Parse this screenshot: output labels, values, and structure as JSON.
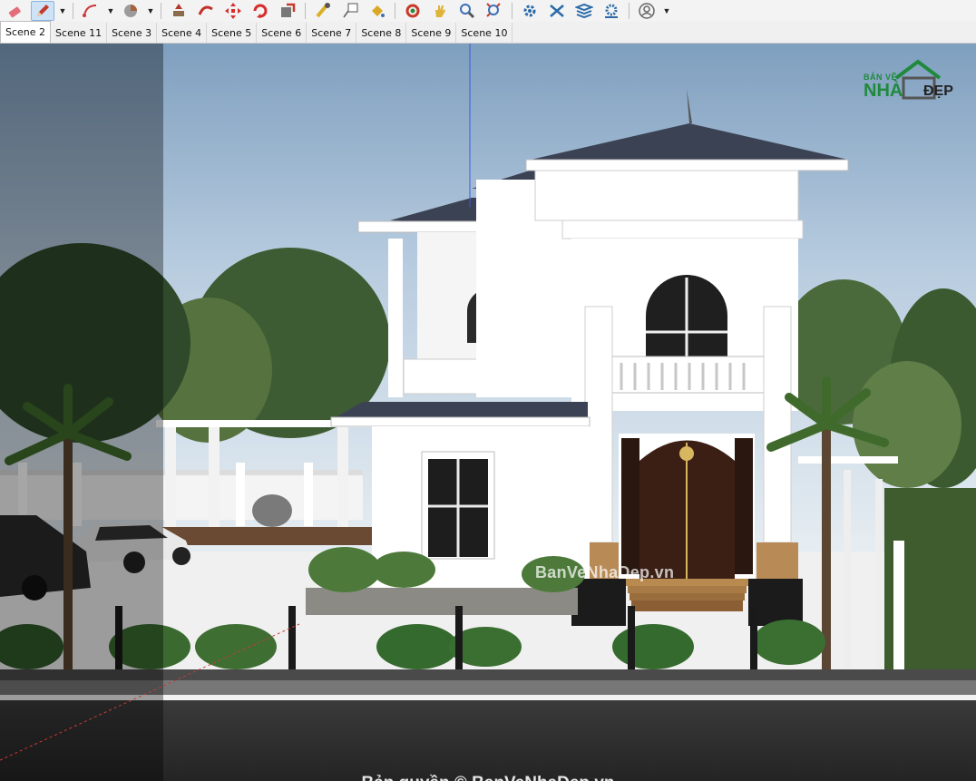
{
  "toolbar": {
    "tools": [
      {
        "icon": "eraser-icon",
        "color": "#e36d7a"
      },
      {
        "icon": "pencil-icon",
        "color": "#c23a2e",
        "active": true
      },
      {
        "icon": "arc-icon",
        "color": "#d0353b"
      },
      {
        "icon": "pie-icon",
        "color": "#a7643a"
      },
      {
        "icon": "push-pull-icon",
        "color": "#b0372b"
      },
      {
        "icon": "follow-me-icon",
        "color": "#c3302a"
      },
      {
        "icon": "move-icon",
        "color": "#d62d2d"
      },
      {
        "icon": "rotate-icon",
        "color": "#d62d2d"
      },
      {
        "icon": "scale-icon",
        "color": "#c8392b"
      },
      {
        "icon": "tape-measure-icon",
        "color": "#d9b024"
      },
      {
        "icon": "text-icon",
        "color": "#555555"
      },
      {
        "icon": "paint-bucket-icon",
        "color": "#d9a826"
      },
      {
        "icon": "orbit-icon",
        "color": "#c83a2a"
      },
      {
        "icon": "pan-icon",
        "color": "#e0b33a"
      },
      {
        "icon": "zoom-icon",
        "color": "#3a6fb8"
      },
      {
        "icon": "zoom-extents-icon",
        "color": "#c8392b"
      },
      {
        "icon": "section-plane-icon",
        "color": "#2a6aa8"
      },
      {
        "icon": "section-cut-icon",
        "color": "#2a6aa8"
      },
      {
        "icon": "layers-icon",
        "color": "#2a6aa8"
      },
      {
        "icon": "settings-gear-icon",
        "color": "#2a6aa8"
      },
      {
        "icon": "user-account-icon",
        "color": "#666666"
      }
    ]
  },
  "scene_tabs": [
    "Scene 2",
    "Scene 11",
    "Scene 3",
    "Scene 4",
    "Scene 5",
    "Scene 6",
    "Scene 7",
    "Scene 8",
    "Scene 9",
    "Scene 10"
  ],
  "active_scene": "Scene 2",
  "logo": {
    "top_text": "BẢN VẼ",
    "brand_left": "NHÀ",
    "brand_right": "ĐẸP"
  },
  "watermark_center": "BanVeNhaDep.vn",
  "copyright": "Bản quyền © BanVeNhaDep.vn",
  "colors": {
    "sky_top": "#7f9fbf",
    "sky_bottom": "#e6edf2",
    "roof": "#3b4254",
    "wall": "#ffffff",
    "door": "#3b1f14",
    "road": "#2f2f2f",
    "grass": "#3e5c2d"
  }
}
